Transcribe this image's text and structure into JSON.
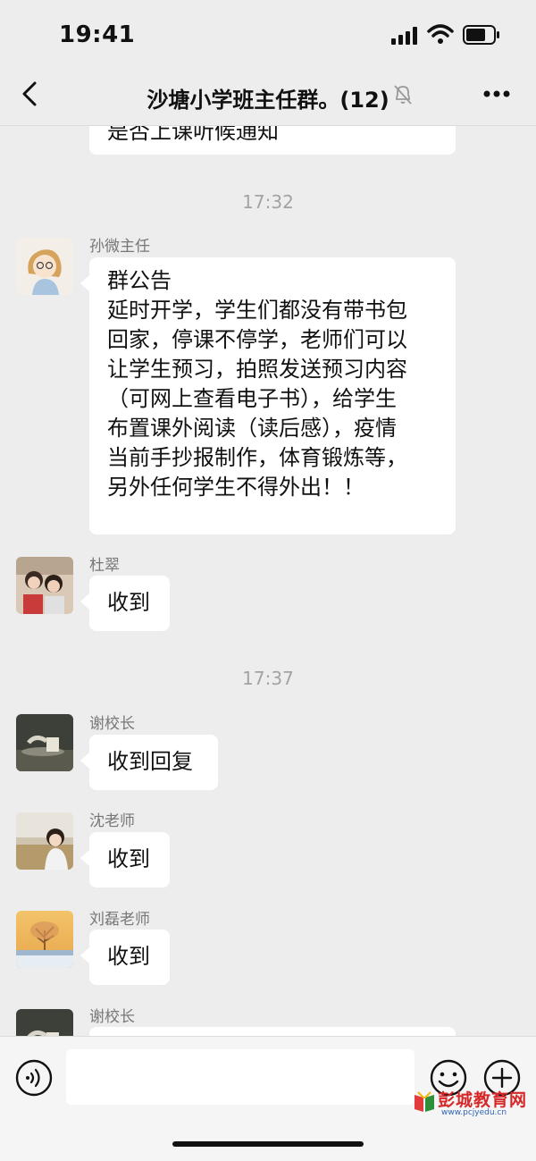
{
  "status_bar": {
    "time": "19:41"
  },
  "header": {
    "title": "沙塘小学班主任群。(12)"
  },
  "messages": {
    "partial_top": {
      "text": "是否上课听候通知"
    },
    "ts1": "17:32",
    "m1": {
      "sender": "孙微主任",
      "lines": [
        "群公告",
        "延时开学，学生们都没有带书包",
        "回家，停课不停学，老师们可以",
        "让学生预习，拍照发送预习内容",
        "（可网上查看电子书），给学生",
        "布置课外阅读（读后感），疫情",
        "当前手抄报制作，体育锻炼等，",
        "另外任何学生不得外出！！"
      ]
    },
    "m2": {
      "sender": "杜翠",
      "text": "收到"
    },
    "ts2": "17:37",
    "m3": {
      "sender": "谢校长",
      "text": "收到回复"
    },
    "m4": {
      "sender": "沈老师",
      "text": "收到"
    },
    "m5": {
      "sender": "刘磊老师",
      "text": "收到"
    },
    "m6": {
      "sender": "谢校长"
    }
  },
  "watermark": {
    "text": "彭城教育网",
    "sub": "www.pcjyedu.cn"
  }
}
